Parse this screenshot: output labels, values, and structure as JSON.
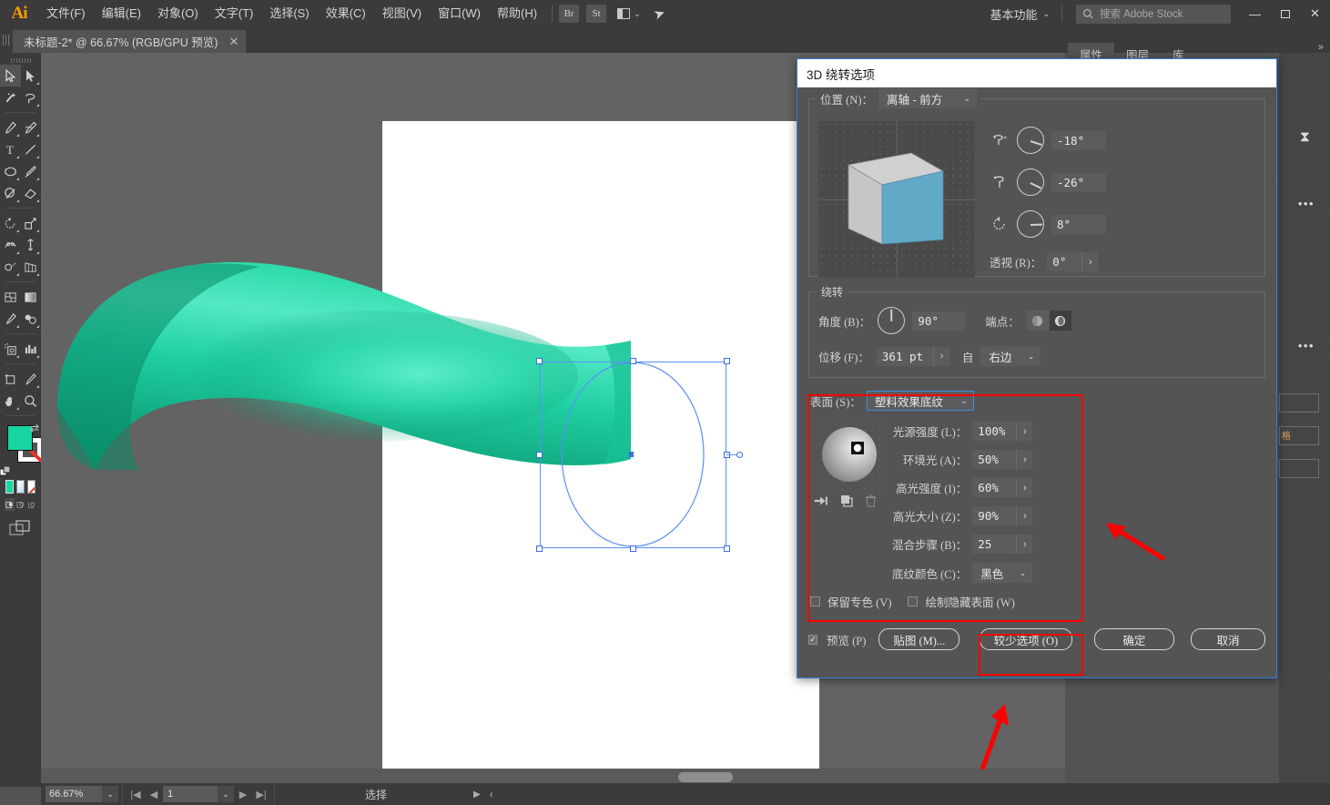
{
  "app": {
    "logo": "Ai",
    "menus": [
      "文件(F)",
      "编辑(E)",
      "对象(O)",
      "文字(T)",
      "选择(S)",
      "效果(C)",
      "视图(V)",
      "窗口(W)",
      "帮助(H)"
    ],
    "bridge_label": "Br",
    "stock_label": "St",
    "workspace": "基本功能",
    "search_placeholder": "搜索 Adobe Stock",
    "win_minimize": "—",
    "win_maximize": "▢",
    "win_close": "✕"
  },
  "tabs": {
    "document_title": "未标题-2* @ 66.67% (RGB/GPU 预览)",
    "close_glyph": "✕",
    "overflow_glyph": "»"
  },
  "statusbar": {
    "zoom": "66.67%",
    "page": "1",
    "status_text": "选择",
    "first_glyph": "|◀",
    "prev_glyph": "◀",
    "next_glyph": "▶",
    "last_glyph": "▶|",
    "right_play": "▶",
    "right_chev": "‹"
  },
  "panels": {
    "tabs": [
      "属性",
      "图层",
      "库"
    ],
    "active_tab": "属性",
    "dots": "•••"
  },
  "dialog": {
    "title": "3D 绕转选项",
    "position": {
      "label": "位置 (N)：",
      "value": "离轴 - 前方",
      "chevron": "⌄"
    },
    "rotation": {
      "x_label": "rotate-x-icon",
      "x_value": "-18°",
      "y_value": "-26°",
      "z_value": "8°",
      "perspective_label": "透视 (R)：",
      "perspective_value": "0°",
      "step_glyph": "›"
    },
    "revolve": {
      "legend": "绕转",
      "angle_label": "角度 (B)：",
      "angle_value": "90°",
      "cap_label": "端点：",
      "offset_label": "位移 (F)：",
      "offset_value": "361 pt",
      "from_label": "自",
      "from_value": "右边"
    },
    "surface": {
      "label": "表面 (S)：",
      "value": "塑料效果底纹",
      "fields": [
        {
          "label": "光源强度 (L)：",
          "value": "100%"
        },
        {
          "label": "环境光 (A)：",
          "value": "50%"
        },
        {
          "label": "高光强度 (I)：",
          "value": "60%"
        },
        {
          "label": "高光大小 (Z)：",
          "value": "90%"
        },
        {
          "label": "混合步骤 (B)：",
          "value": "25"
        }
      ],
      "shading_label": "底纹颜色 (C)：",
      "shading_value": "黑色",
      "preserve_spot_label": "保留专色 (V)",
      "draw_hidden_label": "绘制隐藏表面 (W)",
      "light_add_icon": "add-light-icon",
      "light_dup_icon": "duplicate-light-icon",
      "light_del_icon": "delete-light-icon"
    },
    "footer": {
      "preview_label": "预览 (P)",
      "preview_checked": true,
      "map_button": "贴图 (M)...",
      "less_options_button": "较少选项 (O)",
      "ok_button": "确定",
      "cancel_button": "取消"
    }
  },
  "colors": {
    "accent": "#2f80d8",
    "highlight_red": "#ff0000",
    "fill_swatch": "#18d6a4",
    "cube_front": "#62a9c8",
    "menubar_bg": "#3b3b3b",
    "panel_bg": "#535353",
    "canvas_bg": "#636363",
    "dialog_bg": "#545454"
  },
  "artwork": {
    "name": "3d-revolved-teal-shape",
    "base_color": "#0f9e78",
    "highlight_color": "#3be8be"
  },
  "toolbar": {
    "tools": [
      "selection-tool",
      "direct-selection-tool",
      "magic-wand-tool",
      "lasso-tool",
      "pen-tool",
      "curvature-tool",
      "type-tool",
      "line-segment-tool",
      "ellipse-tool",
      "paintbrush-tool",
      "shaper-tool",
      "eraser-tool",
      "rotate-tool",
      "scale-tool",
      "width-tool",
      "free-transform-tool",
      "shape-builder-tool",
      "perspective-grid-tool",
      "mesh-tool",
      "gradient-tool",
      "eyedropper-tool",
      "blend-tool",
      "symbol-sprayer-tool",
      "column-graph-tool",
      "artboard-tool",
      "slice-tool",
      "hand-tool",
      "zoom-tool"
    ],
    "fill_label": "fill-swatch",
    "stroke_label": "stroke-swatch",
    "swap_label": "swap-fill-stroke-icon",
    "default_label": "default-fill-stroke-icon",
    "color_mode": [
      "color-swatch",
      "gradient-swatch",
      "none-swatch"
    ],
    "draw_modes": [
      "draw-normal",
      "draw-behind",
      "draw-inside"
    ],
    "screen_mode": "change-screen-mode-icon"
  }
}
